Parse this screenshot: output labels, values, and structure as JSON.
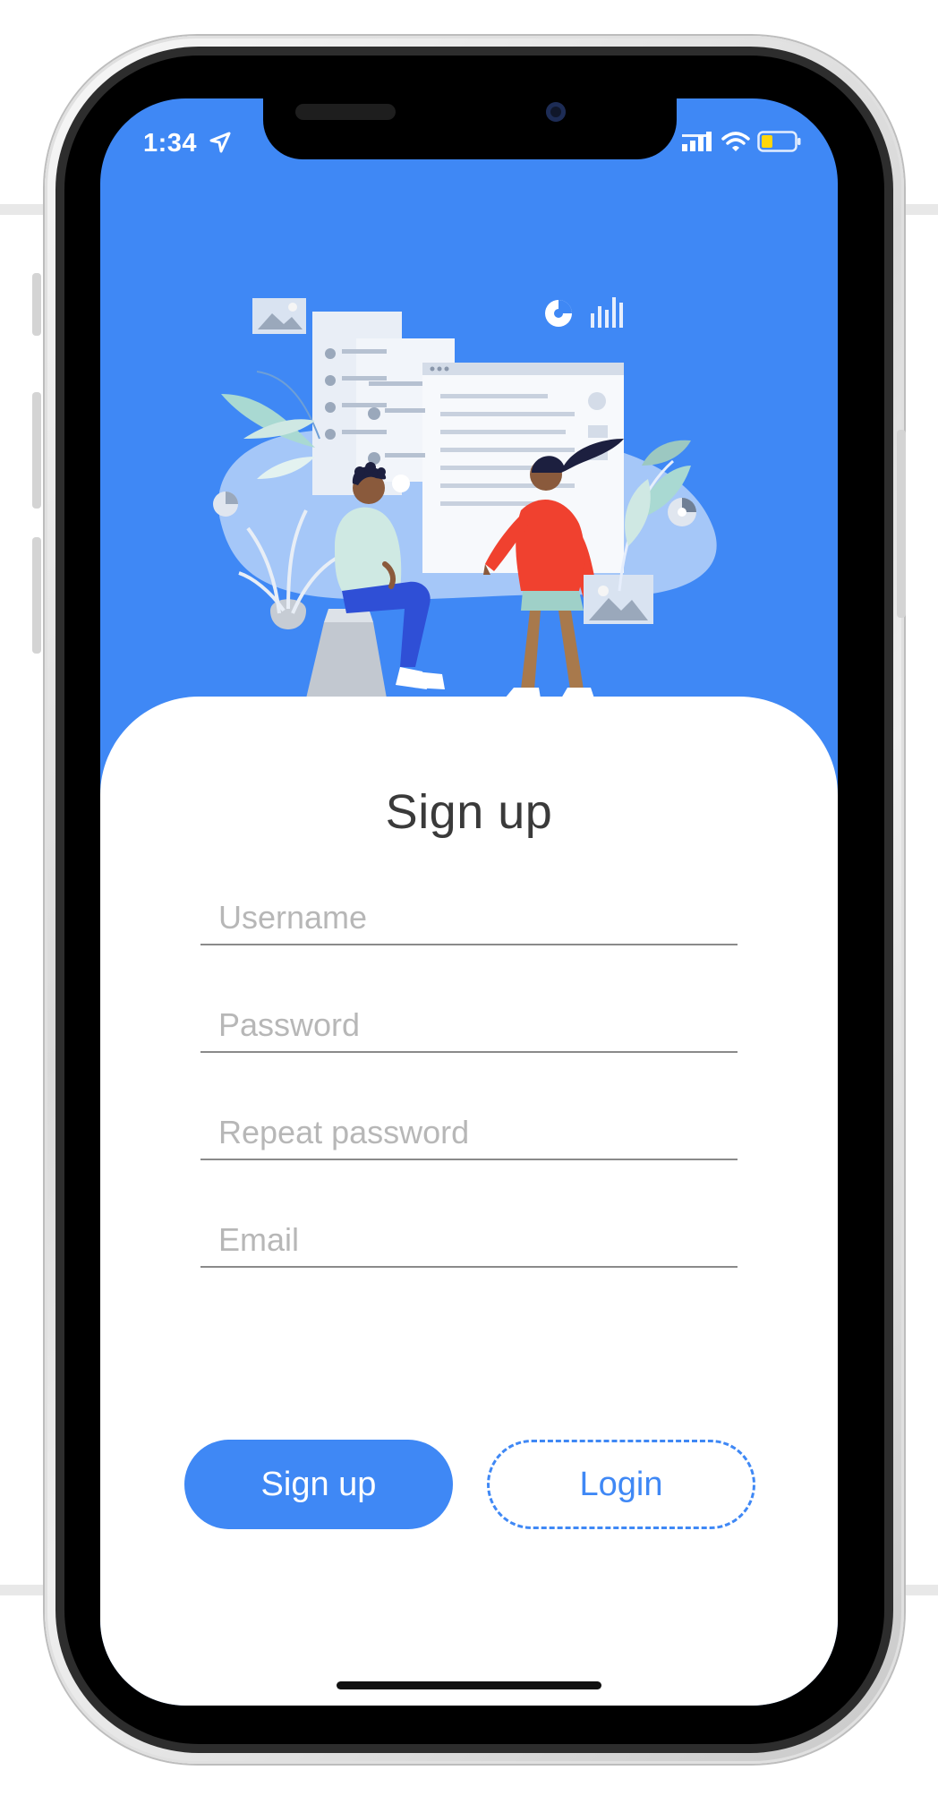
{
  "status_bar": {
    "time": "1:34"
  },
  "signup": {
    "title": "Sign up",
    "username_placeholder": "Username",
    "password_placeholder": "Password",
    "repeat_password_placeholder": "Repeat password",
    "email_placeholder": "Email",
    "signup_button": "Sign up",
    "login_button": "Login"
  },
  "colors": {
    "accent": "#3f88f5",
    "hero_background": "#3f88f5",
    "jacket": "#f0412f"
  },
  "icons": [
    "location-arrow-icon",
    "signal-icon",
    "wifi-icon",
    "battery-icon"
  ]
}
